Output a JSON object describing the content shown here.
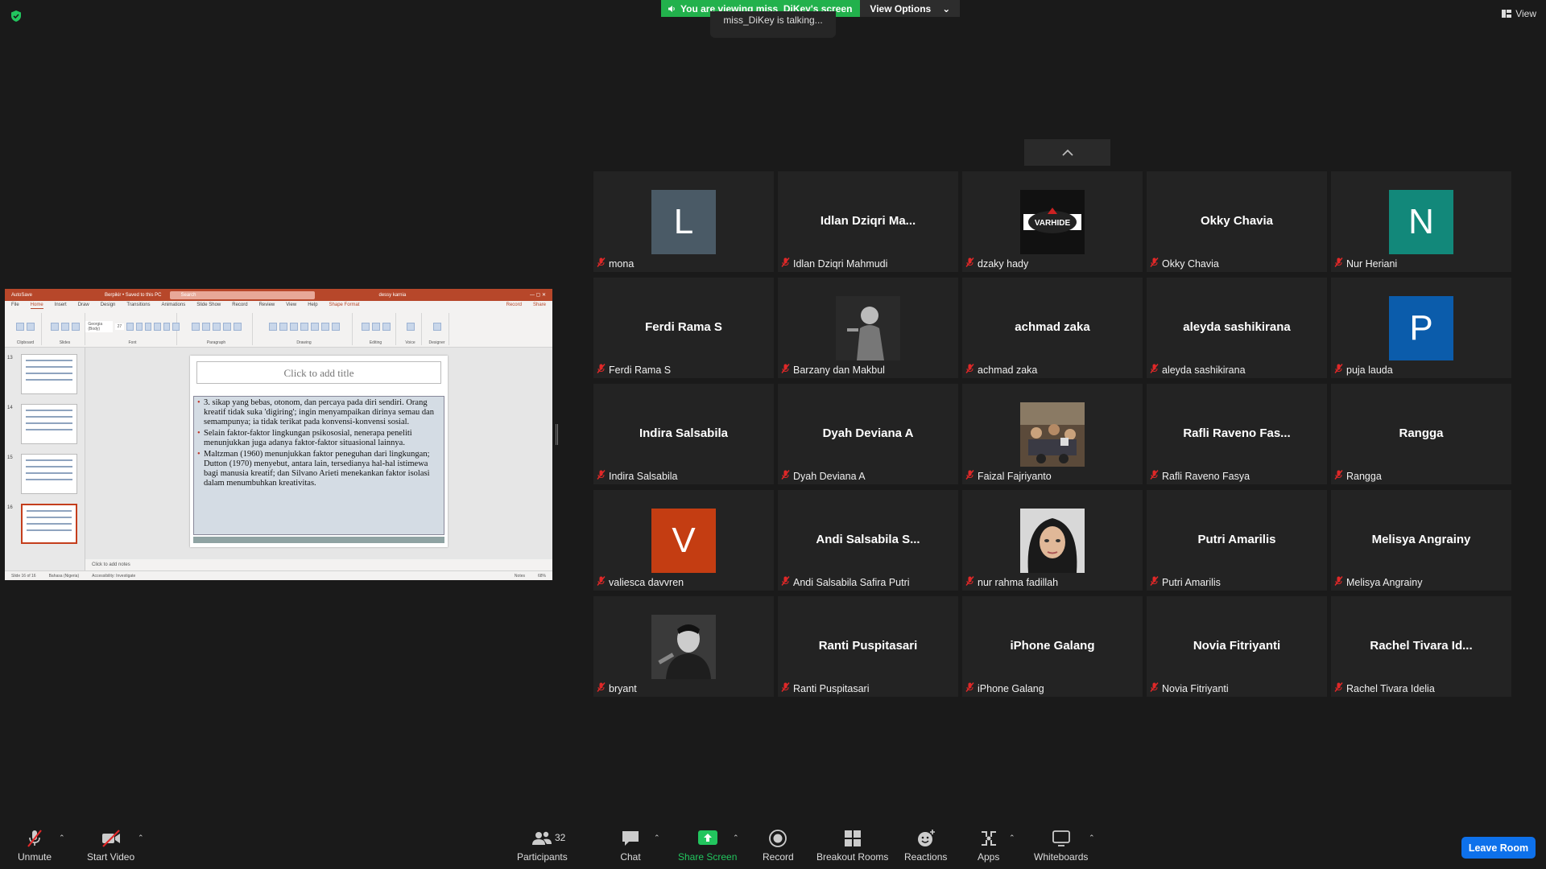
{
  "banner": {
    "viewing": "You are viewing miss_DiKey's screen",
    "view_options": "View Options",
    "talking": "miss_DiKey is talking...",
    "view": "View"
  },
  "ppt": {
    "autosave": "AutoSave",
    "filename": "Berpikir • Saved to this PC",
    "search": "Search",
    "user": "dessy karnia",
    "tabs": [
      "File",
      "Home",
      "Insert",
      "Draw",
      "Design",
      "Transitions",
      "Animations",
      "Slide Show",
      "Record",
      "Review",
      "View",
      "Help",
      "Shape Format"
    ],
    "record_btn": "Record",
    "share_btn": "Share",
    "ribbon_groups": [
      "Clipboard",
      "Slides",
      "Font",
      "Paragraph",
      "Drawing",
      "Editing",
      "Voice",
      "Designer"
    ],
    "font_name": "Georgia (Body)",
    "font_size": "27",
    "slide_numbers": [
      "13",
      "14",
      "15",
      "16"
    ],
    "slide_title_placeholder": "Click to add title",
    "bullets": [
      "3. sikap yang bebas, otonom, dan percaya pada diri sendiri. Orang kreatif tidak suka 'digiring'; ingin menyampaikan dirinya semau dan semampunya; ia tidak terikat pada konvensi-konvensi sosial.",
      "Selain faktor-faktor lingkungan psikososial, nenerapa peneliti menunjukkan juga adanya faktor-faktor situasional lainnya.",
      "Maltzman (1960) menunjukkan faktor peneguhan dari lingkungan; Dutton (1970) menyebut, antara lain, tersedianya hal-hal istimewa bagi manusia kreatif; dan Silvano Arieti menekankan faktor isolasi dalam menumbuhkan kreativitas."
    ],
    "notes_placeholder": "Click to add notes",
    "status": {
      "slide": "Slide 16 of 16",
      "language": "Bahasa (Nigeria)",
      "accessibility": "Accessibility: Investigate",
      "notes": "Notes",
      "zoom": "68%"
    }
  },
  "participants": [
    {
      "name": "mona",
      "display": "L",
      "type": "avatar",
      "color": "#4a5a66"
    },
    {
      "name": "Idlan Dziqri Mahmudi",
      "display": "Idlan  Dziqri  Ma...",
      "type": "text"
    },
    {
      "name": "dzaky hady",
      "display": "VARHIDE",
      "type": "logo"
    },
    {
      "name": "Okky Chavia",
      "display": "Okky Chavia",
      "type": "text"
    },
    {
      "name": "Nur Heriani",
      "display": "N",
      "type": "avatar",
      "color": "#12887a"
    },
    {
      "name": "Ferdi Rama S",
      "display": "Ferdi Rama S",
      "type": "text"
    },
    {
      "name": "Barzany dan Makbul",
      "display": "",
      "type": "photo-bw"
    },
    {
      "name": "achmad zaka",
      "display": "achmad zaka",
      "type": "text"
    },
    {
      "name": "aleyda sashikirana",
      "display": "aleyda sashikirana",
      "type": "text"
    },
    {
      "name": "puja lauda",
      "display": "P",
      "type": "avatar",
      "color": "#0b5cab"
    },
    {
      "name": "Indira Salsabila",
      "display": "Indira Salsabila",
      "type": "text"
    },
    {
      "name": "Dyah Deviana A",
      "display": "Dyah Deviana A",
      "type": "text"
    },
    {
      "name": "Faizal Fajriyanto",
      "display": "",
      "type": "photo-color"
    },
    {
      "name": "Rafli Raveno Fasya",
      "display": "Rafli Raveno Fas...",
      "type": "text"
    },
    {
      "name": "Rangga",
      "display": "Rangga",
      "type": "text"
    },
    {
      "name": "valiesca davvren",
      "display": "V",
      "type": "avatar",
      "color": "#c43d12"
    },
    {
      "name": "Andi Salsabila Safira Putri",
      "display": "Andi  Salsabila  S...",
      "type": "text"
    },
    {
      "name": "nur rahma fadillah",
      "display": "",
      "type": "photo-face"
    },
    {
      "name": "Putri Amarilis",
      "display": "Putri Amarilis",
      "type": "text"
    },
    {
      "name": "Melisya Angrainy",
      "display": "Melisya Angrainy",
      "type": "text"
    },
    {
      "name": "bryant",
      "display": "",
      "type": "photo-bw2"
    },
    {
      "name": "Ranti Puspitasari",
      "display": "Ranti Puspitasari",
      "type": "text"
    },
    {
      "name": "iPhone Galang",
      "display": "iPhone Galang",
      "type": "text"
    },
    {
      "name": "Novia Fitriyanti",
      "display": "Novia Fitriyanti",
      "type": "text"
    },
    {
      "name": "Rachel Tivara Idelia",
      "display": "Rachel  Tivara  Id...",
      "type": "text"
    }
  ],
  "toolbar": {
    "unmute": "Unmute",
    "start_video": "Start Video",
    "participants": "Participants",
    "participants_count": "32",
    "chat": "Chat",
    "share_screen": "Share Screen",
    "record": "Record",
    "breakout_rooms": "Breakout Rooms",
    "reactions": "Reactions",
    "apps": "Apps",
    "whiteboards": "Whiteboards",
    "leave_room": "Leave Room"
  },
  "colors": {
    "banner_green": "#22b14c",
    "leave_blue": "#0e71eb",
    "muted_red": "#e02828",
    "ppt_red": "#b7472a"
  }
}
